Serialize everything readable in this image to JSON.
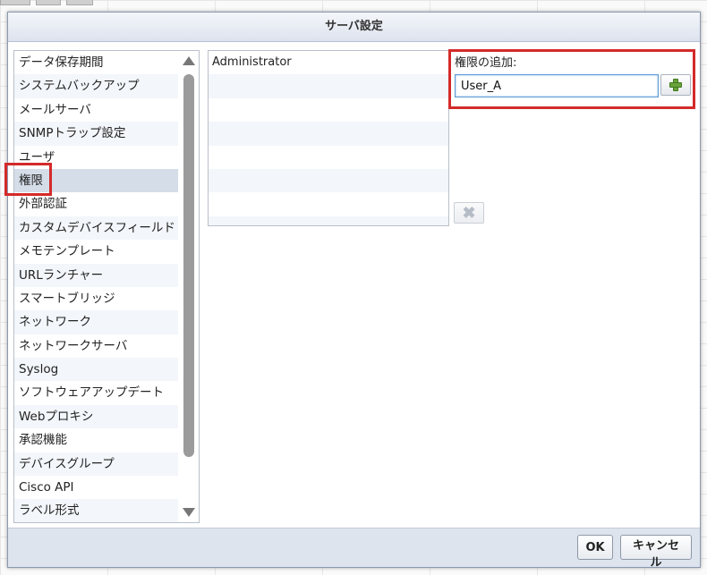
{
  "dialog": {
    "title": "サーバ設定"
  },
  "nav": {
    "items": [
      "データ保存期間",
      "システムバックアップ",
      "メールサーバ",
      "SNMPトラップ設定",
      "ユーザ",
      "権限",
      "外部認証",
      "カスタムデバイスフィールド",
      "メモテンプレート",
      "URLランチャー",
      "スマートブリッジ",
      "ネットワーク",
      "ネットワークサーバ",
      "Syslog",
      "ソフトウェアアップデート",
      "Webプロキシ",
      "承認機能",
      "デバイスグループ",
      "Cisco API",
      "ラベル形式"
    ],
    "selected_index": 5
  },
  "permissions": {
    "rows": [
      "Administrator",
      "",
      "",
      "",
      "",
      "",
      "",
      ""
    ]
  },
  "add_permission": {
    "label": "権限の追加:",
    "value": "User_A"
  },
  "buttons": {
    "ok": "OK",
    "cancel": "キャンセル"
  },
  "icons": {
    "add": "plus-icon",
    "delete": "x-icon",
    "scroll_up": "triangle-up-icon",
    "scroll_down": "triangle-down-icon"
  },
  "colors": {
    "highlight": "#d42a2a",
    "selected_row": "#d5dde8",
    "footer": "#dde4ee",
    "plus_green": "#6aa13a"
  }
}
